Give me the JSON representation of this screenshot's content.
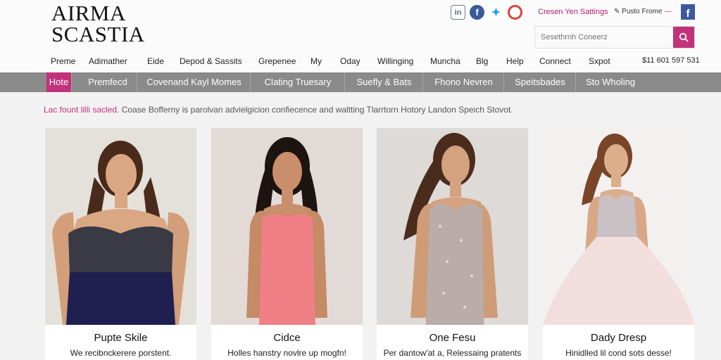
{
  "brand": {
    "line1": "AIRMA",
    "line2": "SCASTIA"
  },
  "social": {
    "linkedin_icon": "linkedin-icon",
    "facebook_icon": "facebook-icon",
    "twitter_icon": "twitter-icon",
    "google_icon": "google-icon"
  },
  "top_links": {
    "create": "Cresen Yen Sattings",
    "profile": "Pusto Frome"
  },
  "search": {
    "placeholder": "Sesethrnh Coneerz"
  },
  "nav": {
    "items": [
      "Preme",
      "Adimather",
      "Eide",
      "Depod & Sassits",
      "Grepenee",
      "My",
      "Oday",
      "Willinging",
      "Muncha",
      "Blg",
      "Help",
      "Connect",
      "Sxpot"
    ],
    "phone": "$11 601 597 531"
  },
  "categories": [
    "Hote",
    "Premfecd",
    "Covenand Kayl Momes",
    "Clating Truesary",
    "Suefly & Bats",
    "Fhono Nevren",
    "Speitsbades",
    "Sto Wholing"
  ],
  "info": {
    "highlight": "Lac fount lilli sacled.",
    "text": "Coase Bofferny is parolvan advielgicion confiecence and waltting Tlarrtorn Hotory Landon Speich Stovot."
  },
  "products": [
    {
      "name": "Pupte Skile",
      "desc": "We recibnckerere porstent.",
      "dress_color": "#1f2050",
      "bodice_color": "#3a3a44",
      "bg": "#e4e0da"
    },
    {
      "name": "Cidce",
      "desc": "Holles hanstry novlre up mogfn!",
      "dress_color": "#f07f86",
      "bodice_color": "#f07f86",
      "bg": "#e2dad6"
    },
    {
      "name": "One Fesu",
      "desc": "Per dantow'at a, Relessaing pratents",
      "dress_color": "#b9aca9",
      "bodice_color": "#c8bdbb",
      "bg": "#dedad7"
    },
    {
      "name": "Dady Dresp",
      "desc": "Hinidlled lil cond sots desse!",
      "dress_color": "#f3dede",
      "bodice_color": "#c9c1c4",
      "bg": "#f3f0f0"
    }
  ],
  "colors": {
    "accent": "#c2327a",
    "category_bar": "#8a8a8a"
  }
}
